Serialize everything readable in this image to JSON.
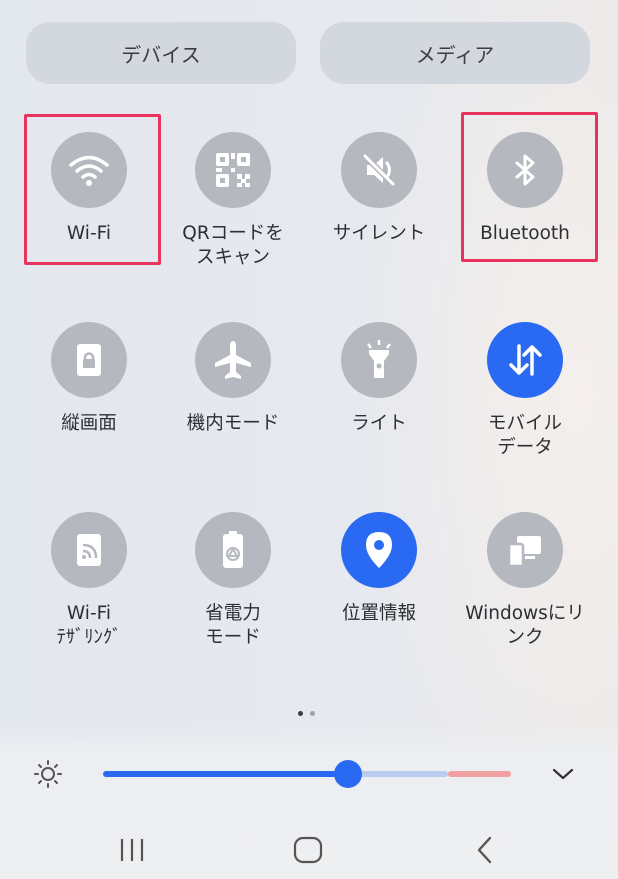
{
  "top_buttons": {
    "device": "デバイス",
    "media": "メディア"
  },
  "tiles": [
    {
      "label": "Wi-Fi",
      "icon": "wifi-icon",
      "state": "off"
    },
    {
      "label": "QRコードを\nスキャン",
      "icon": "qr-code-icon",
      "state": "off"
    },
    {
      "label": "サイレント",
      "icon": "mute-icon",
      "state": "off"
    },
    {
      "label": "Bluetooth",
      "icon": "bluetooth-icon",
      "state": "off"
    },
    {
      "label": "縦画面",
      "icon": "portrait-lock-icon",
      "state": "off"
    },
    {
      "label": "機内モード",
      "icon": "airplane-icon",
      "state": "off"
    },
    {
      "label": "ライト",
      "icon": "flashlight-icon",
      "state": "off"
    },
    {
      "label": "モバイル\nデータ",
      "icon": "mobile-data-icon",
      "state": "on"
    },
    {
      "label": "Wi-Fi\nﾃｻﾞﾘﾝｸﾞ",
      "icon": "hotspot-icon",
      "state": "off"
    },
    {
      "label": "省電力\nモード",
      "icon": "power-saving-icon",
      "state": "off"
    },
    {
      "label": "位置情報",
      "icon": "location-icon",
      "state": "on"
    },
    {
      "label": "Windowsにリ\nンク",
      "icon": "link-to-windows-icon",
      "state": "off"
    }
  ],
  "highlighted_tiles": [
    "Wi-Fi",
    "Bluetooth"
  ],
  "page_indicator": {
    "pages": 2,
    "current": 1
  },
  "brightness": {
    "level": 0.65
  },
  "colors": {
    "accent": "#2a6af2",
    "tile_off": "#b5b8be",
    "highlight": "#e8335f",
    "warning_segment": "#f0a0a0"
  }
}
